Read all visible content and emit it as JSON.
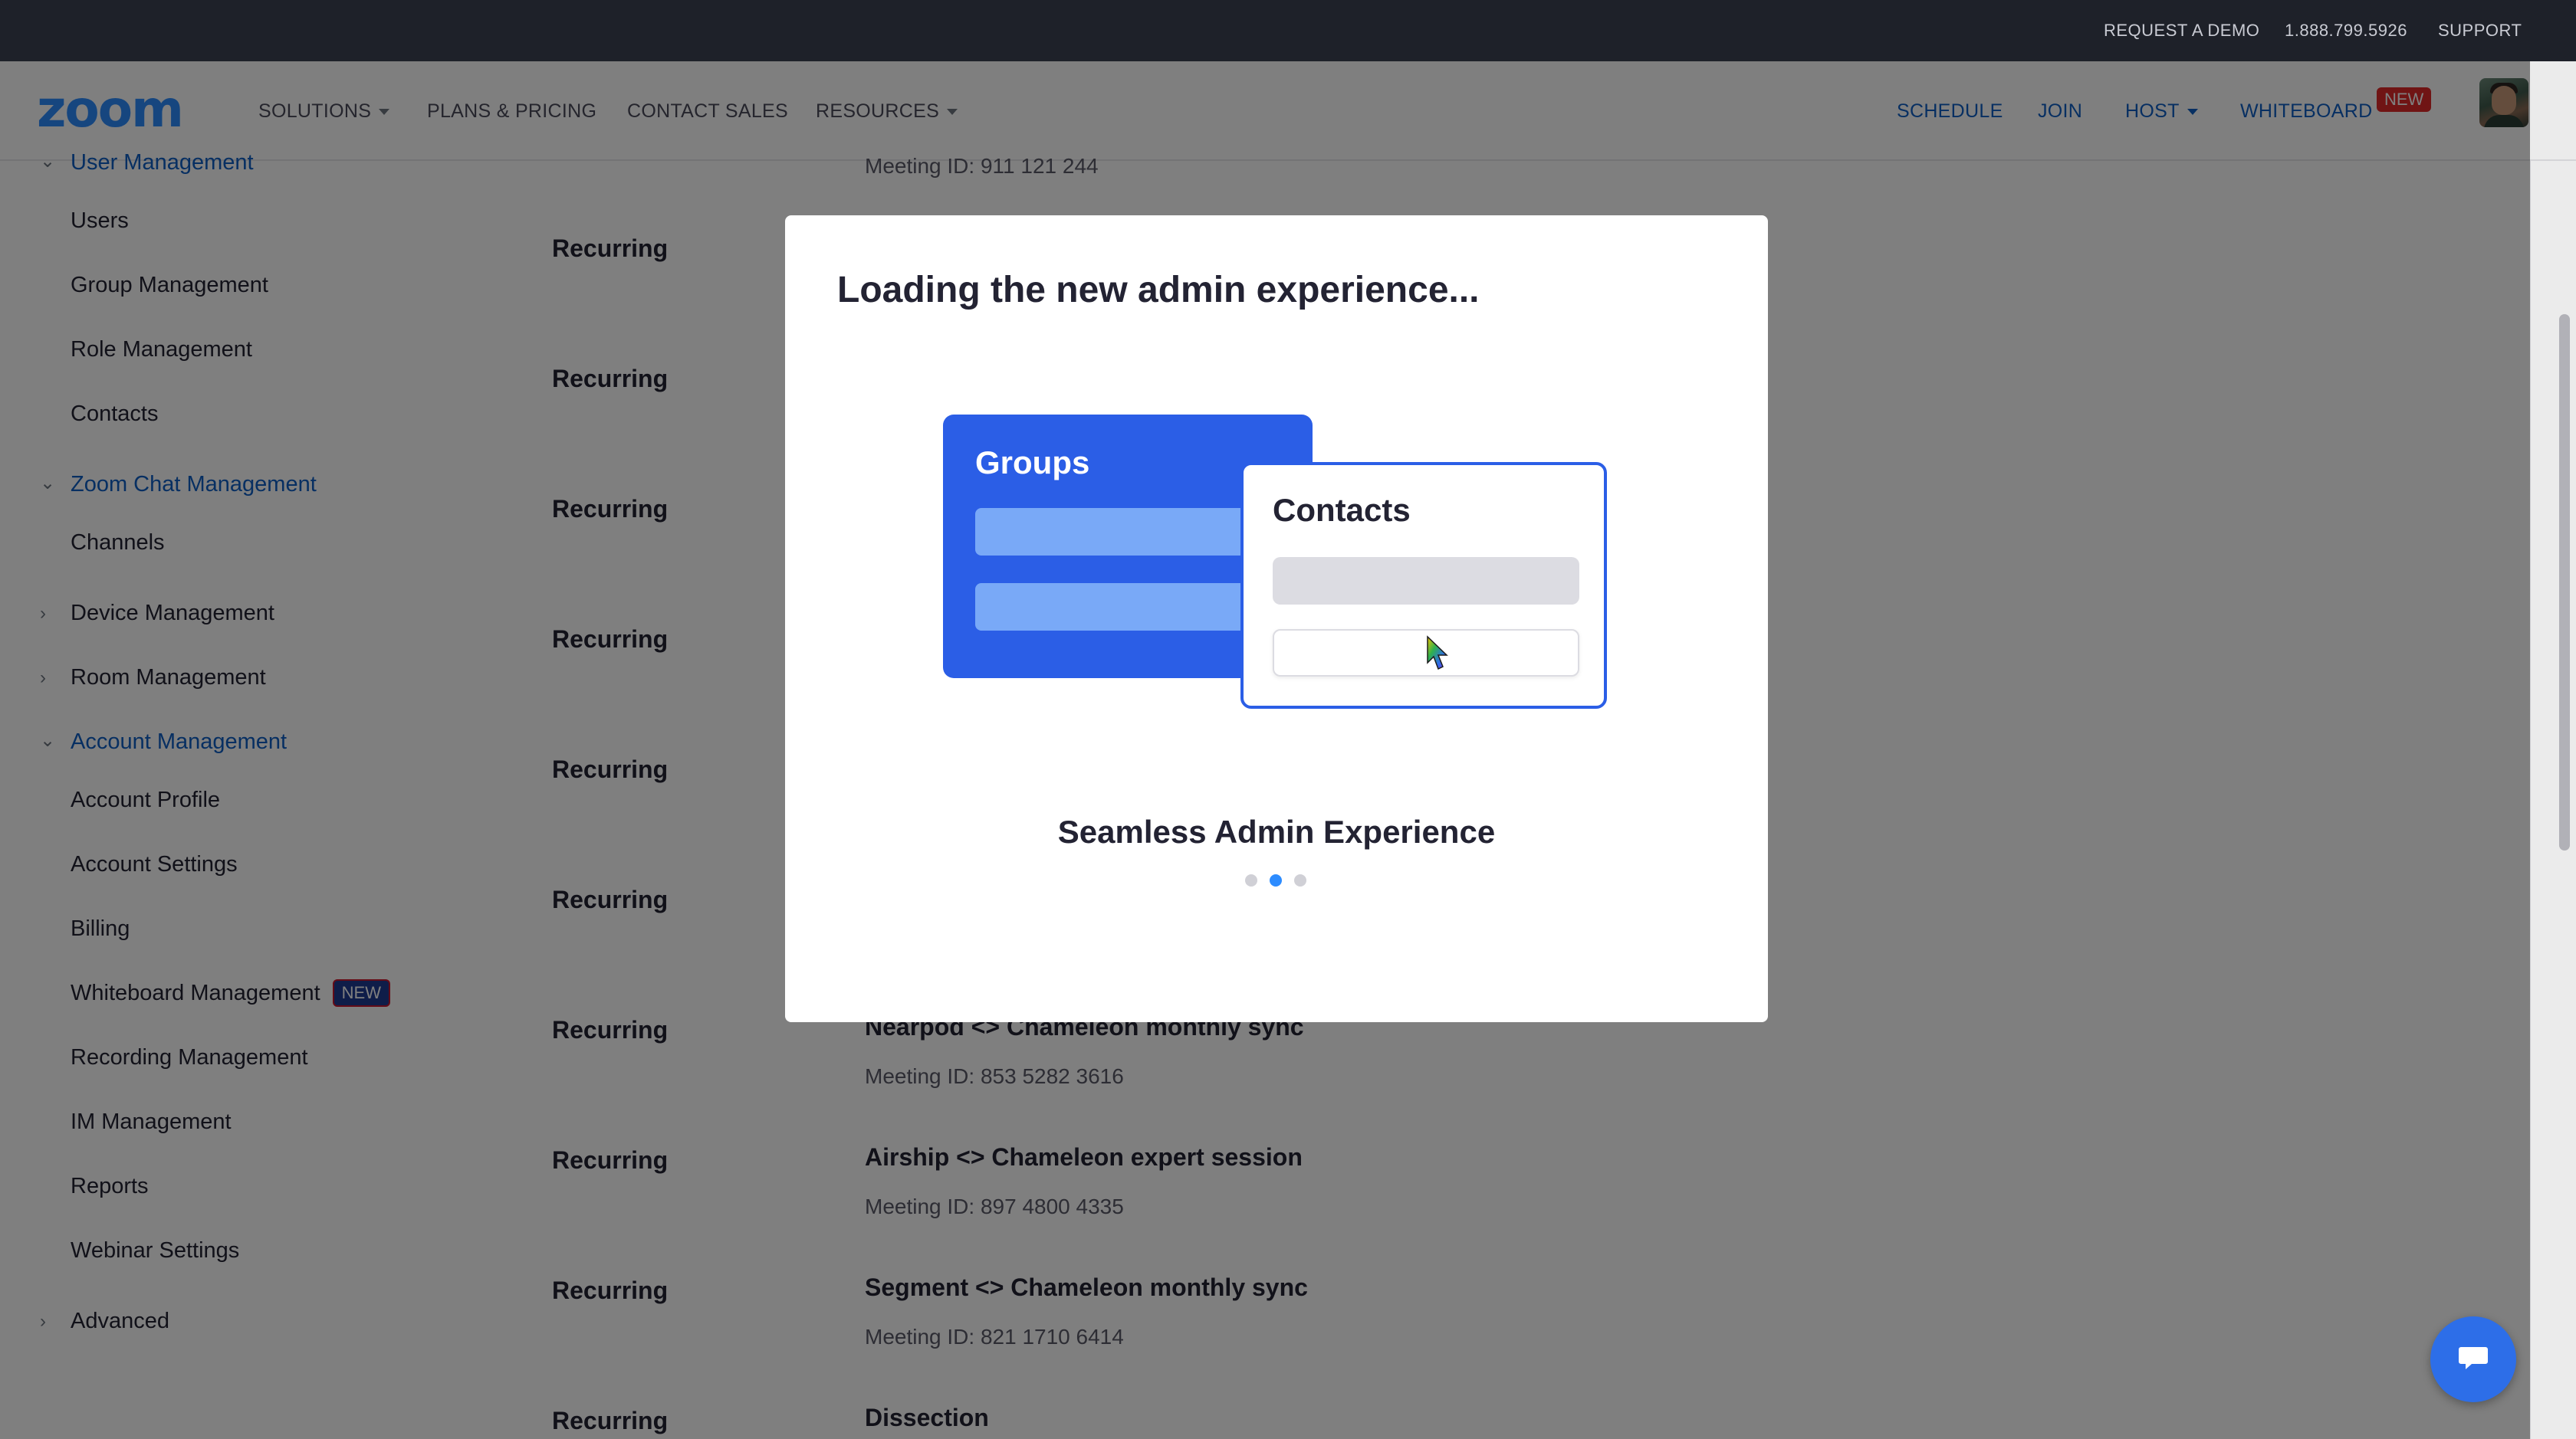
{
  "topbar": {
    "request_demo": "REQUEST A DEMO",
    "phone": "1.888.799.5926",
    "support": "SUPPORT"
  },
  "nav": {
    "logo": "zoom",
    "solutions": "SOLUTIONS",
    "plans": "PLANS & PRICING",
    "contact_sales": "CONTACT SALES",
    "resources": "RESOURCES",
    "schedule": "SCHEDULE",
    "join": "JOIN",
    "host": "HOST",
    "whiteboard": "WHITEBOARD",
    "whiteboard_badge": "NEW"
  },
  "sidebar": {
    "user_management": "User Management",
    "users": "Users",
    "group_management": "Group Management",
    "role_management": "Role Management",
    "contacts": "Contacts",
    "chat_management": "Zoom Chat Management",
    "channels": "Channels",
    "device_management": "Device Management",
    "room_management": "Room Management",
    "account_management": "Account Management",
    "account_profile": "Account Profile",
    "account_settings": "Account Settings",
    "billing": "Billing",
    "whiteboard_management": "Whiteboard Management",
    "whiteboard_badge": "NEW",
    "recording_management": "Recording Management",
    "im_management": "IM Management",
    "reports": "Reports",
    "webinar_settings": "Webinar Settings",
    "advanced": "Advanced"
  },
  "meetings": {
    "first_id": "Meeting ID: 911 121 244",
    "rows": [
      {
        "type": "Recurring"
      },
      {
        "type": "Recurring"
      },
      {
        "type": "Recurring"
      },
      {
        "type": "Recurring"
      },
      {
        "type": "Recurring"
      },
      {
        "type": "Recurring"
      },
      {
        "type": "Recurring",
        "title": "Nearpod <> Chameleon monthly sync",
        "meeting_id": "Meeting ID: 853 5282 3616"
      },
      {
        "type": "Recurring",
        "title": "Airship <> Chameleon expert session",
        "meeting_id": "Meeting ID: 897 4800 4335"
      },
      {
        "type": "Recurring",
        "title": "Segment <> Chameleon monthly sync",
        "meeting_id": "Meeting ID: 821 1710 6414"
      },
      {
        "type": "Recurring",
        "title": "Dissection"
      }
    ]
  },
  "modal": {
    "title": "Loading the new admin experience...",
    "groups_label": "Groups",
    "contacts_label": "Contacts",
    "caption": "Seamless Admin Experience",
    "active_slide": 2,
    "total_slides": 3
  },
  "colors": {
    "brand": "#2d8cff",
    "nav_link_blue": "#0e5fc5",
    "groups_card": "#2b5ee6",
    "topbar": "#1e2129",
    "badge_red": "#e02828"
  },
  "icons": {
    "chat_fab": "chat-bubble-icon",
    "cursor": "mouse-cursor-icon"
  }
}
